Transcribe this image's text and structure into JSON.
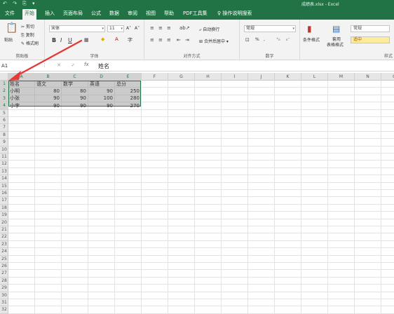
{
  "titlebar": {
    "quick_access": "↶ ↷ ⎘ ▾",
    "document_title": "成绩表.xlsx - Excel"
  },
  "tabs": [
    {
      "label": "文件",
      "active": false
    },
    {
      "label": "开始",
      "active": true
    },
    {
      "label": "插入",
      "active": false
    },
    {
      "label": "页面布局",
      "active": false
    },
    {
      "label": "公式",
      "active": false
    },
    {
      "label": "数据",
      "active": false
    },
    {
      "label": "审阅",
      "active": false
    },
    {
      "label": "视图",
      "active": false
    },
    {
      "label": "帮助",
      "active": false
    },
    {
      "label": "PDF工具集",
      "active": false
    }
  ],
  "tell_me": "操作说明搜索",
  "ribbon": {
    "clipboard": {
      "paste": "粘贴",
      "cut": "剪切",
      "copy": "复制",
      "format_painter": "格式刷",
      "group_label": "剪贴板"
    },
    "font": {
      "font_name": "宋体",
      "font_size": "11",
      "grow": "A˄",
      "shrink": "A˅",
      "bold": "B",
      "italic": "I",
      "underline": "U",
      "group_label": "字体"
    },
    "alignment": {
      "wrap_text": "自动换行",
      "merge_center": "合并后居中",
      "group_label": "对齐方式"
    },
    "number": {
      "format": "常规",
      "percent": "%",
      "comma": ",",
      "group_label": "数字"
    },
    "styles": {
      "conditional_format": "条件格式",
      "table_format_line1": "套用",
      "table_format_line2": "表格格式",
      "style_normal": "常规",
      "style_neutral": "适中",
      "group_label": "样式"
    }
  },
  "formula_bar": {
    "name_box": "A1",
    "fx": "fx",
    "content": "姓名"
  },
  "columns": [
    "A",
    "B",
    "C",
    "D",
    "E",
    "F",
    "G",
    "H",
    "I",
    "J",
    "K",
    "L",
    "M",
    "N",
    "O"
  ],
  "rows": [
    "1",
    "2",
    "3",
    "4",
    "5",
    "6",
    "7",
    "8",
    "9",
    "10",
    "11",
    "12",
    "13",
    "14",
    "15",
    "16",
    "17",
    "18",
    "19",
    "20",
    "21",
    "22",
    "23",
    "24",
    "25",
    "26",
    "27",
    "28",
    "29",
    "30",
    "31",
    "32"
  ],
  "table": {
    "headers": [
      "姓名",
      "语文",
      "数学",
      "英语",
      "总分"
    ],
    "rows": [
      [
        "小明",
        "80",
        "80",
        "90",
        "250"
      ],
      [
        "小张",
        "90",
        "90",
        "100",
        "280"
      ],
      [
        "小李",
        "90",
        "90",
        "90",
        "270"
      ]
    ]
  },
  "colors": {
    "accent": "#217346",
    "arrow": "#e53935"
  }
}
